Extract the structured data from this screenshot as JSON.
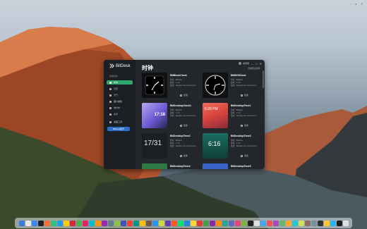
{
  "app": {
    "name": "BitDesk",
    "section_heading": "选择组件",
    "page_title": "时钟",
    "user_name": "未登录",
    "subtitle": "查看更多组件"
  },
  "sidebar": {
    "items": [
      {
        "label": "时钟"
      },
      {
        "label": "日历"
      },
      {
        "label": "天气"
      },
      {
        "label": "图片相框"
      },
      {
        "label": "倒计时"
      },
      {
        "label": "文字"
      }
    ],
    "settings_label": "桌面工具",
    "cta_label": "BitDesk助手"
  },
  "window_controls": [
    "—",
    "□",
    "✕"
  ],
  "cards": [
    {
      "title": "BitBlockClock",
      "author": "作者：BitDesk",
      "version": "版本：1.0.0",
      "desc": "描述：Displays the current time.",
      "use": "使用",
      "time": ""
    },
    {
      "title": "BitDIGIClock",
      "author": "作者：BitDesk",
      "version": "版本：1.0.0",
      "desc": "描述：Displays the current time.",
      "use": "使用",
      "time": ""
    },
    {
      "title": "BitDesktopClock1",
      "author": "作者：BitDesk",
      "version": "版本：1.0.0",
      "desc": "描述：Displays the current time.",
      "use": "使用",
      "time": "17:18"
    },
    {
      "title": "BitDesktopTime1",
      "author": "作者：BitDesk",
      "version": "版本：1.0.0",
      "desc": "描述：Displays the current time.",
      "use": "使用",
      "time": "5:28 PM"
    },
    {
      "title": "BitDesktopTime2",
      "author": "作者：BitDesk",
      "version": "版本：1.0.0",
      "desc": "描述：Displays the current time.",
      "use": "使用",
      "time": "17/31"
    },
    {
      "title": "BitDesktopTime3",
      "author": "作者：BitDesk",
      "version": "版本：1.0.0",
      "desc": "描述：Displays the current time.",
      "use": "使用",
      "time": "6:16"
    },
    {
      "title": "BitDesktopTime4",
      "author": "",
      "version": "",
      "desc": "",
      "use": "",
      "time": ""
    },
    {
      "title": "BitDesktopTime5",
      "author": "",
      "version": "",
      "desc": "",
      "use": "",
      "time": ""
    }
  ],
  "dock_colors": [
    "#3b7ddd",
    "#e8e8e8",
    "#3a86ff",
    "#222",
    "#ff6b35",
    "#2ec27e",
    "#1f9bf0",
    "#ffcc00",
    "#d7263d",
    "#4caf50",
    "#e91e63",
    "#00bcd4",
    "#ff9800",
    "#9c27b0",
    "#607d8b",
    "#8bc34a",
    "#3f51b5",
    "#f44336",
    "#009688",
    "#ffc107",
    "#795548",
    "#2196f3",
    "#cddc39",
    "#673ab7",
    "#ff5722",
    "#00e676",
    "#1e88e5",
    "#fdd835",
    "#e53935",
    "#43a047",
    "#8e24aa",
    "#fb8c00",
    "#26a69a",
    "#5c6bc0",
    "#ec407a",
    "#7cb342",
    "#222",
    "#e0e0e0",
    "#42a5f5",
    "#ef5350",
    "#ab47bc",
    "#66bb6a",
    "#ffa726",
    "#26c6da",
    "#d4e157",
    "#8d6e63",
    "#78909c",
    "#333",
    "#ffca28",
    "#29b6f6",
    "#1e1e1e",
    "#e0e0e0"
  ]
}
